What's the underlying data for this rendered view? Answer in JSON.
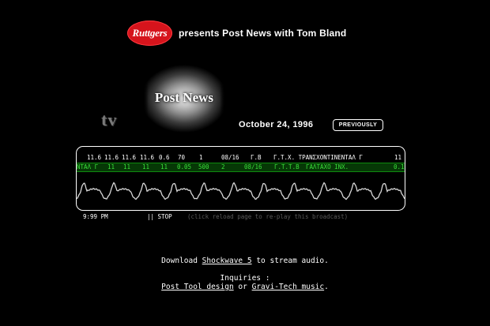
{
  "header": {
    "logo_text": "Ruttgers",
    "text": "presents Post News with Tom Bland",
    "brand_color": "#d6141c"
  },
  "show": {
    "title": "Post News",
    "tv_logo": "tv",
    "date": "October 24, 1996",
    "previously_label": "PREVIOUSLY"
  },
  "ticker": {
    "row1": [
      "11.6",
      "11.6",
      "11.6",
      "11.6",
      "0.6",
      "70",
      "1",
      "08/16",
      "Γ.Β",
      "Γ.Τ.Χ. ΤΡΑΝΣΧΟΝΤΙΝΕΝΤΑΛ Γ",
      "11"
    ],
    "row2": [
      "ΝΤΑΛ Γ",
      "11",
      "11",
      "11",
      "11",
      "0.05",
      "500",
      "2",
      "08/16",
      "Γ.Τ.Τ.Β",
      "ΓΑΛΤΑΧΟ ΙΝΧ.",
      "0.1"
    ],
    "row2_color": "#3ae03a"
  },
  "controls": {
    "time": "9:99 PM",
    "stop_label": "|| STOP",
    "replay_hint": "(click reload page to re-play this broadcast)"
  },
  "footer": {
    "download_prefix": "Download",
    "shockwave_link": "Shockwave 5",
    "download_suffix": "to stream audio.",
    "inquiries_label": "Inquiries :",
    "post_tool_link": "Post Tool design",
    "or_text": "or",
    "gravitech_link": "Gravi-Tech music",
    "period": "."
  }
}
